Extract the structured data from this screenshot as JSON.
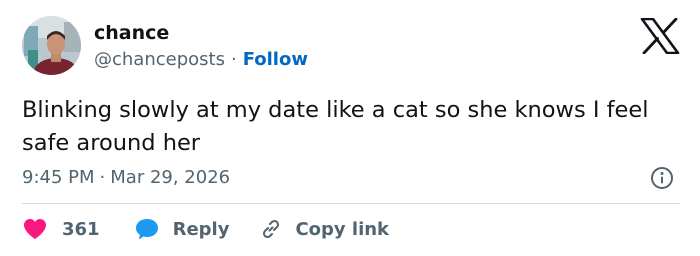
{
  "author": {
    "display_name": "chance",
    "handle": "@chanceposts",
    "separator": "·",
    "follow_label": "Follow"
  },
  "tweet": {
    "text": "Blinking slowly at my date like a cat so she knows I feel safe around her",
    "time": "9:45 PM",
    "separator": "·",
    "date": "Mar 29, 2026"
  },
  "actions": {
    "like_count": "361",
    "reply_label": "Reply",
    "copy_link_label": "Copy link"
  },
  "icons": {
    "brand": "x-logo-icon",
    "info": "info-icon",
    "like": "heart-icon",
    "reply": "speech-bubble-icon",
    "copy": "link-icon"
  },
  "colors": {
    "text_primary": "#0f1419",
    "text_secondary": "#536471",
    "follow_blue": "#0069c2",
    "heart_red": "#f91880",
    "reply_blue": "#1d9bf0",
    "divider": "#cfd9de"
  }
}
